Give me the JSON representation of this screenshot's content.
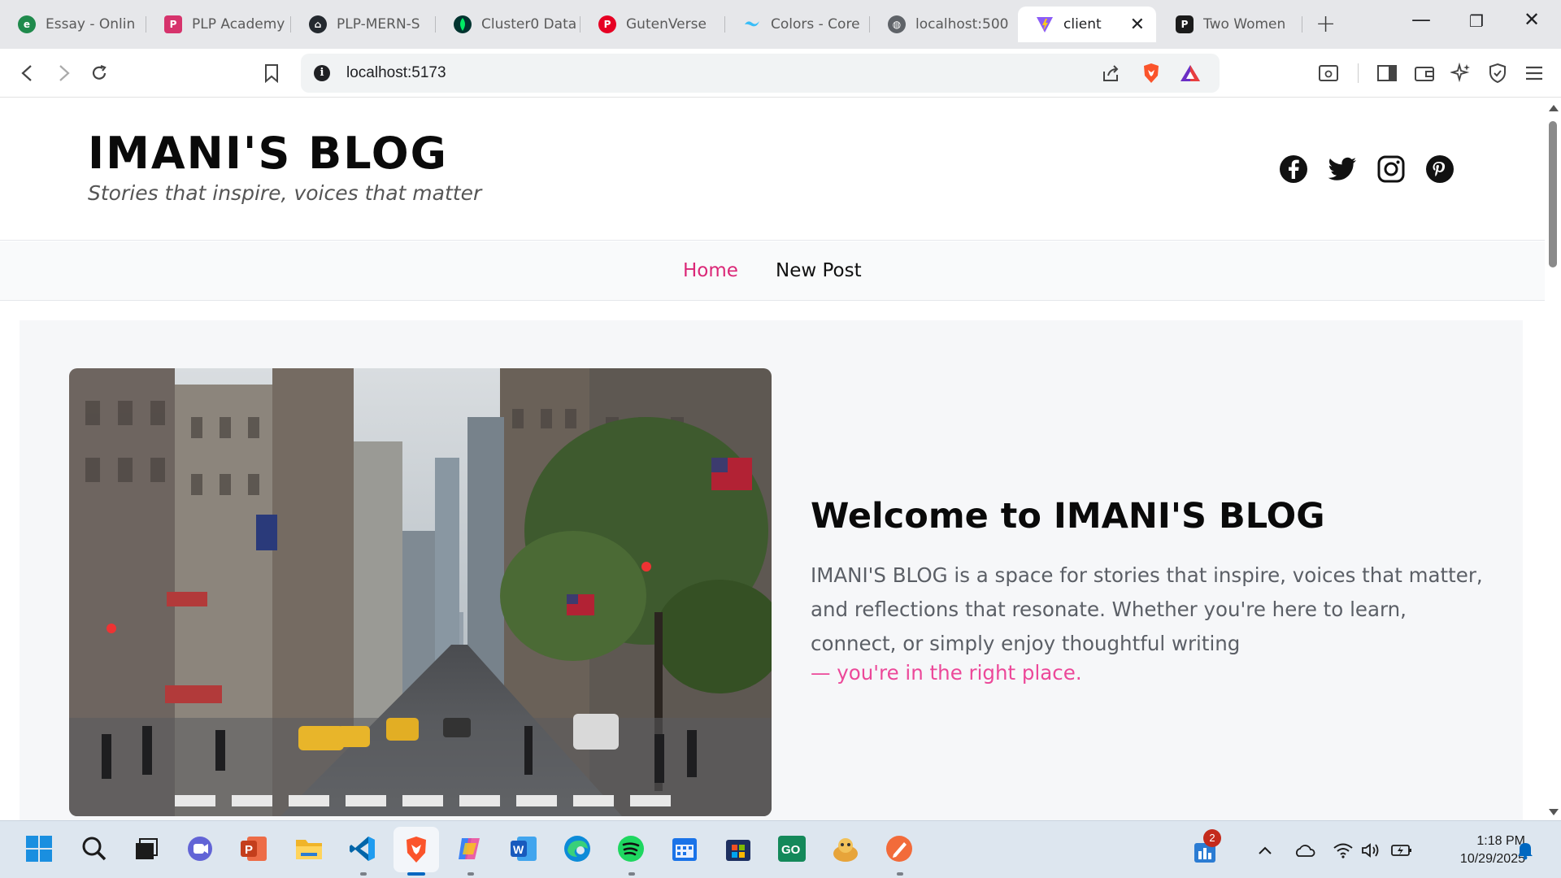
{
  "browser": {
    "tabs": [
      {
        "title": "Essay - Onlin",
        "icon": "essay-favicon"
      },
      {
        "title": "PLP Academy",
        "icon": "plp-favicon"
      },
      {
        "title": "PLP-MERN-S",
        "icon": "github-favicon"
      },
      {
        "title": "Cluster0 Data",
        "icon": "mongodb-favicon"
      },
      {
        "title": "GutenVerse",
        "icon": "pinterest-favicon"
      },
      {
        "title": "Colors - Core",
        "icon": "tailwind-favicon"
      },
      {
        "title": "localhost:500",
        "icon": "globe-favicon"
      },
      {
        "title": "client",
        "icon": "vite-favicon"
      },
      {
        "title": "Two Women",
        "icon": "pexels-favicon"
      }
    ],
    "active_tab": "client",
    "address": "localhost:5173"
  },
  "site": {
    "logo": "IMANI'S BLOG",
    "tagline": "Stories that inspire, voices that matter",
    "socials": [
      "facebook-icon",
      "twitter-icon",
      "instagram-icon",
      "pinterest-icon"
    ],
    "nav": [
      {
        "label": "Home",
        "active": true
      },
      {
        "label": "New Post",
        "active": false
      }
    ]
  },
  "hero": {
    "title": "Welcome to IMANI'S BLOG",
    "body": "IMANI'S BLOG is a space for stories that inspire, voices that matter, and reflections that resonate. Whether you're here to learn, connect, or simply enjoy thoughtful writing",
    "accent": "— you're in the right place.",
    "image": "city-street-photo"
  },
  "taskbar": {
    "apps": [
      "start",
      "search",
      "task-view",
      "teams",
      "powerpoint",
      "file-explorer",
      "vscode",
      "brave",
      "copilot",
      "word",
      "edge",
      "spotify",
      "calendar",
      "store",
      "app-green",
      "app-figure",
      "app-orange"
    ],
    "widget_badge": "2",
    "time": "1:18 PM",
    "date": "10/29/2025"
  },
  "colors": {
    "accent": "#db2777",
    "accent_light": "#ec4899"
  }
}
